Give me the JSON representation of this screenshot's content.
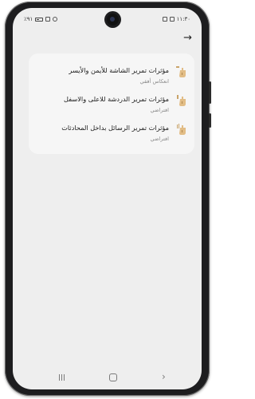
{
  "status_bar": {
    "time": "١١:٣٠",
    "battery": "٪٩١"
  },
  "header": {
    "back_icon": "right-arrow-icon",
    "back_glyph": "→"
  },
  "settings": {
    "items": [
      {
        "title": "مؤثرات تمرير الشاشة للأيمن والأيسر",
        "value": "انعكاس أفقي",
        "icon": "swipe-horizontal-icon"
      },
      {
        "title": "مؤثرات تمرير الدردشة للاعلى والاسفل",
        "value": "افتراضي",
        "icon": "swipe-vertical-icon"
      },
      {
        "title": "مؤثرات تمرير الرسائل بداخل المحادثات",
        "value": "افتراضي",
        "icon": "swipe-messages-icon"
      }
    ]
  },
  "nav": {
    "recents_icon": "recents-icon",
    "home_icon": "home-icon",
    "back_icon": "back-chevron-icon",
    "back_glyph": "›"
  }
}
